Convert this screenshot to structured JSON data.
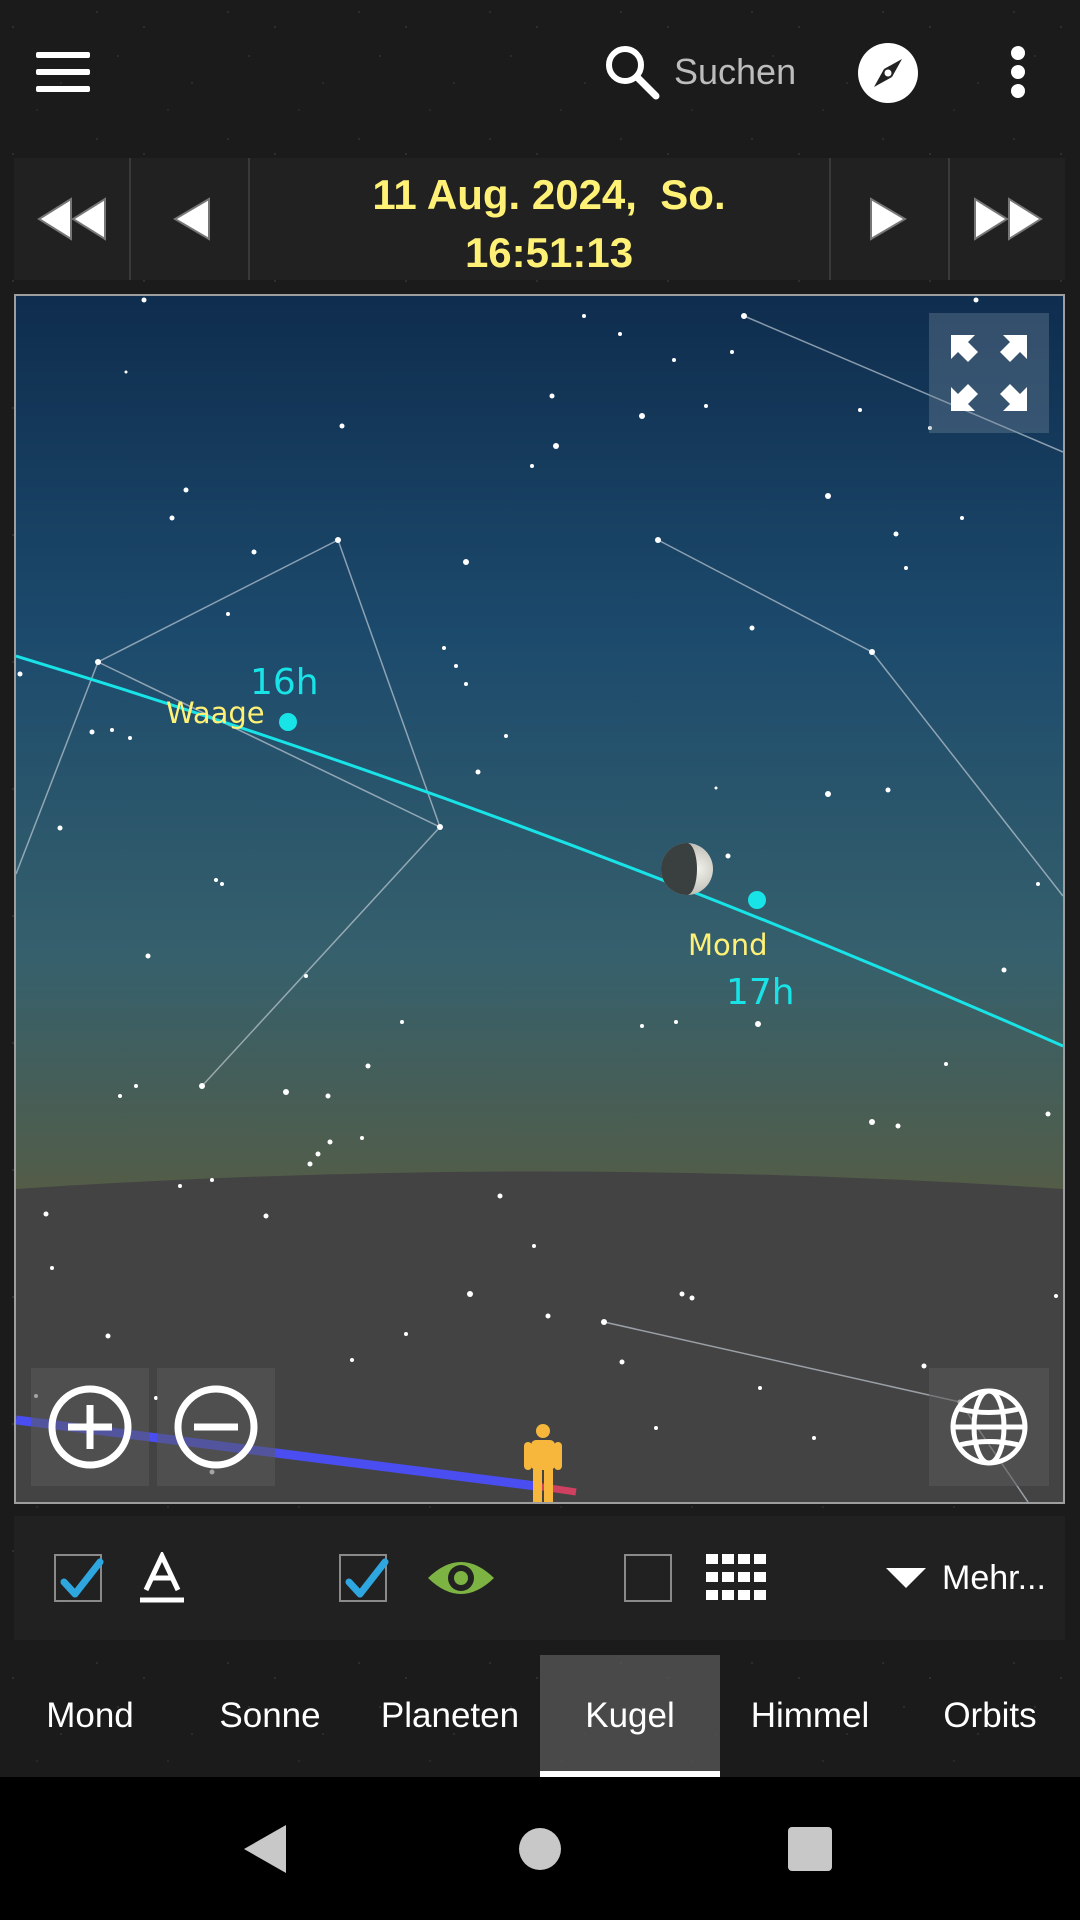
{
  "appbar": {
    "menu_icon": "hamburger-menu-icon",
    "search_placeholder": "Suchen",
    "search_icon": "search-icon",
    "compass_icon": "compass-icon",
    "overflow_icon": "more-vert-icon"
  },
  "datebar": {
    "date_line": "11 Aug. 2024,  So.",
    "time_line": "16:51:13",
    "date_color": "#fff176",
    "icons": [
      "fast-rewind-icon",
      "step-back-icon",
      "step-forward-icon",
      "fast-forward-icon"
    ]
  },
  "sky": {
    "ecliptic_color": "#18e4e8",
    "label_color": "#fff176",
    "labels": {
      "waage": "Waage",
      "mond": "Mond",
      "hour_16": "16h",
      "hour_17": "17h"
    },
    "icons": {
      "fullscreen": "fullscreen-icon",
      "zoom_in": "zoom-in-icon",
      "zoom_out": "zoom-out-icon",
      "globe": "globe-icon",
      "observer": "person-icon",
      "moon": "moon-icon"
    }
  },
  "options": {
    "labels_checked": true,
    "visibility_checked": true,
    "grid_checked": false,
    "more_label": "Mehr...",
    "icons": [
      "text-label-icon",
      "eye-icon",
      "grid-icon",
      "dropdown-triangle-icon"
    ],
    "accent_color": "#2ea7e0",
    "eye_color": "#7cb342"
  },
  "tabs": [
    {
      "label": "Mond",
      "active": false
    },
    {
      "label": "Sonne",
      "active": false
    },
    {
      "label": "Planeten",
      "active": false
    },
    {
      "label": "Kugel",
      "active": true
    },
    {
      "label": "Himmel",
      "active": false
    },
    {
      "label": "Orbits",
      "active": false
    }
  ],
  "system_nav": {
    "icons": [
      "back-triangle-icon",
      "home-circle-icon",
      "recents-square-icon"
    ]
  }
}
